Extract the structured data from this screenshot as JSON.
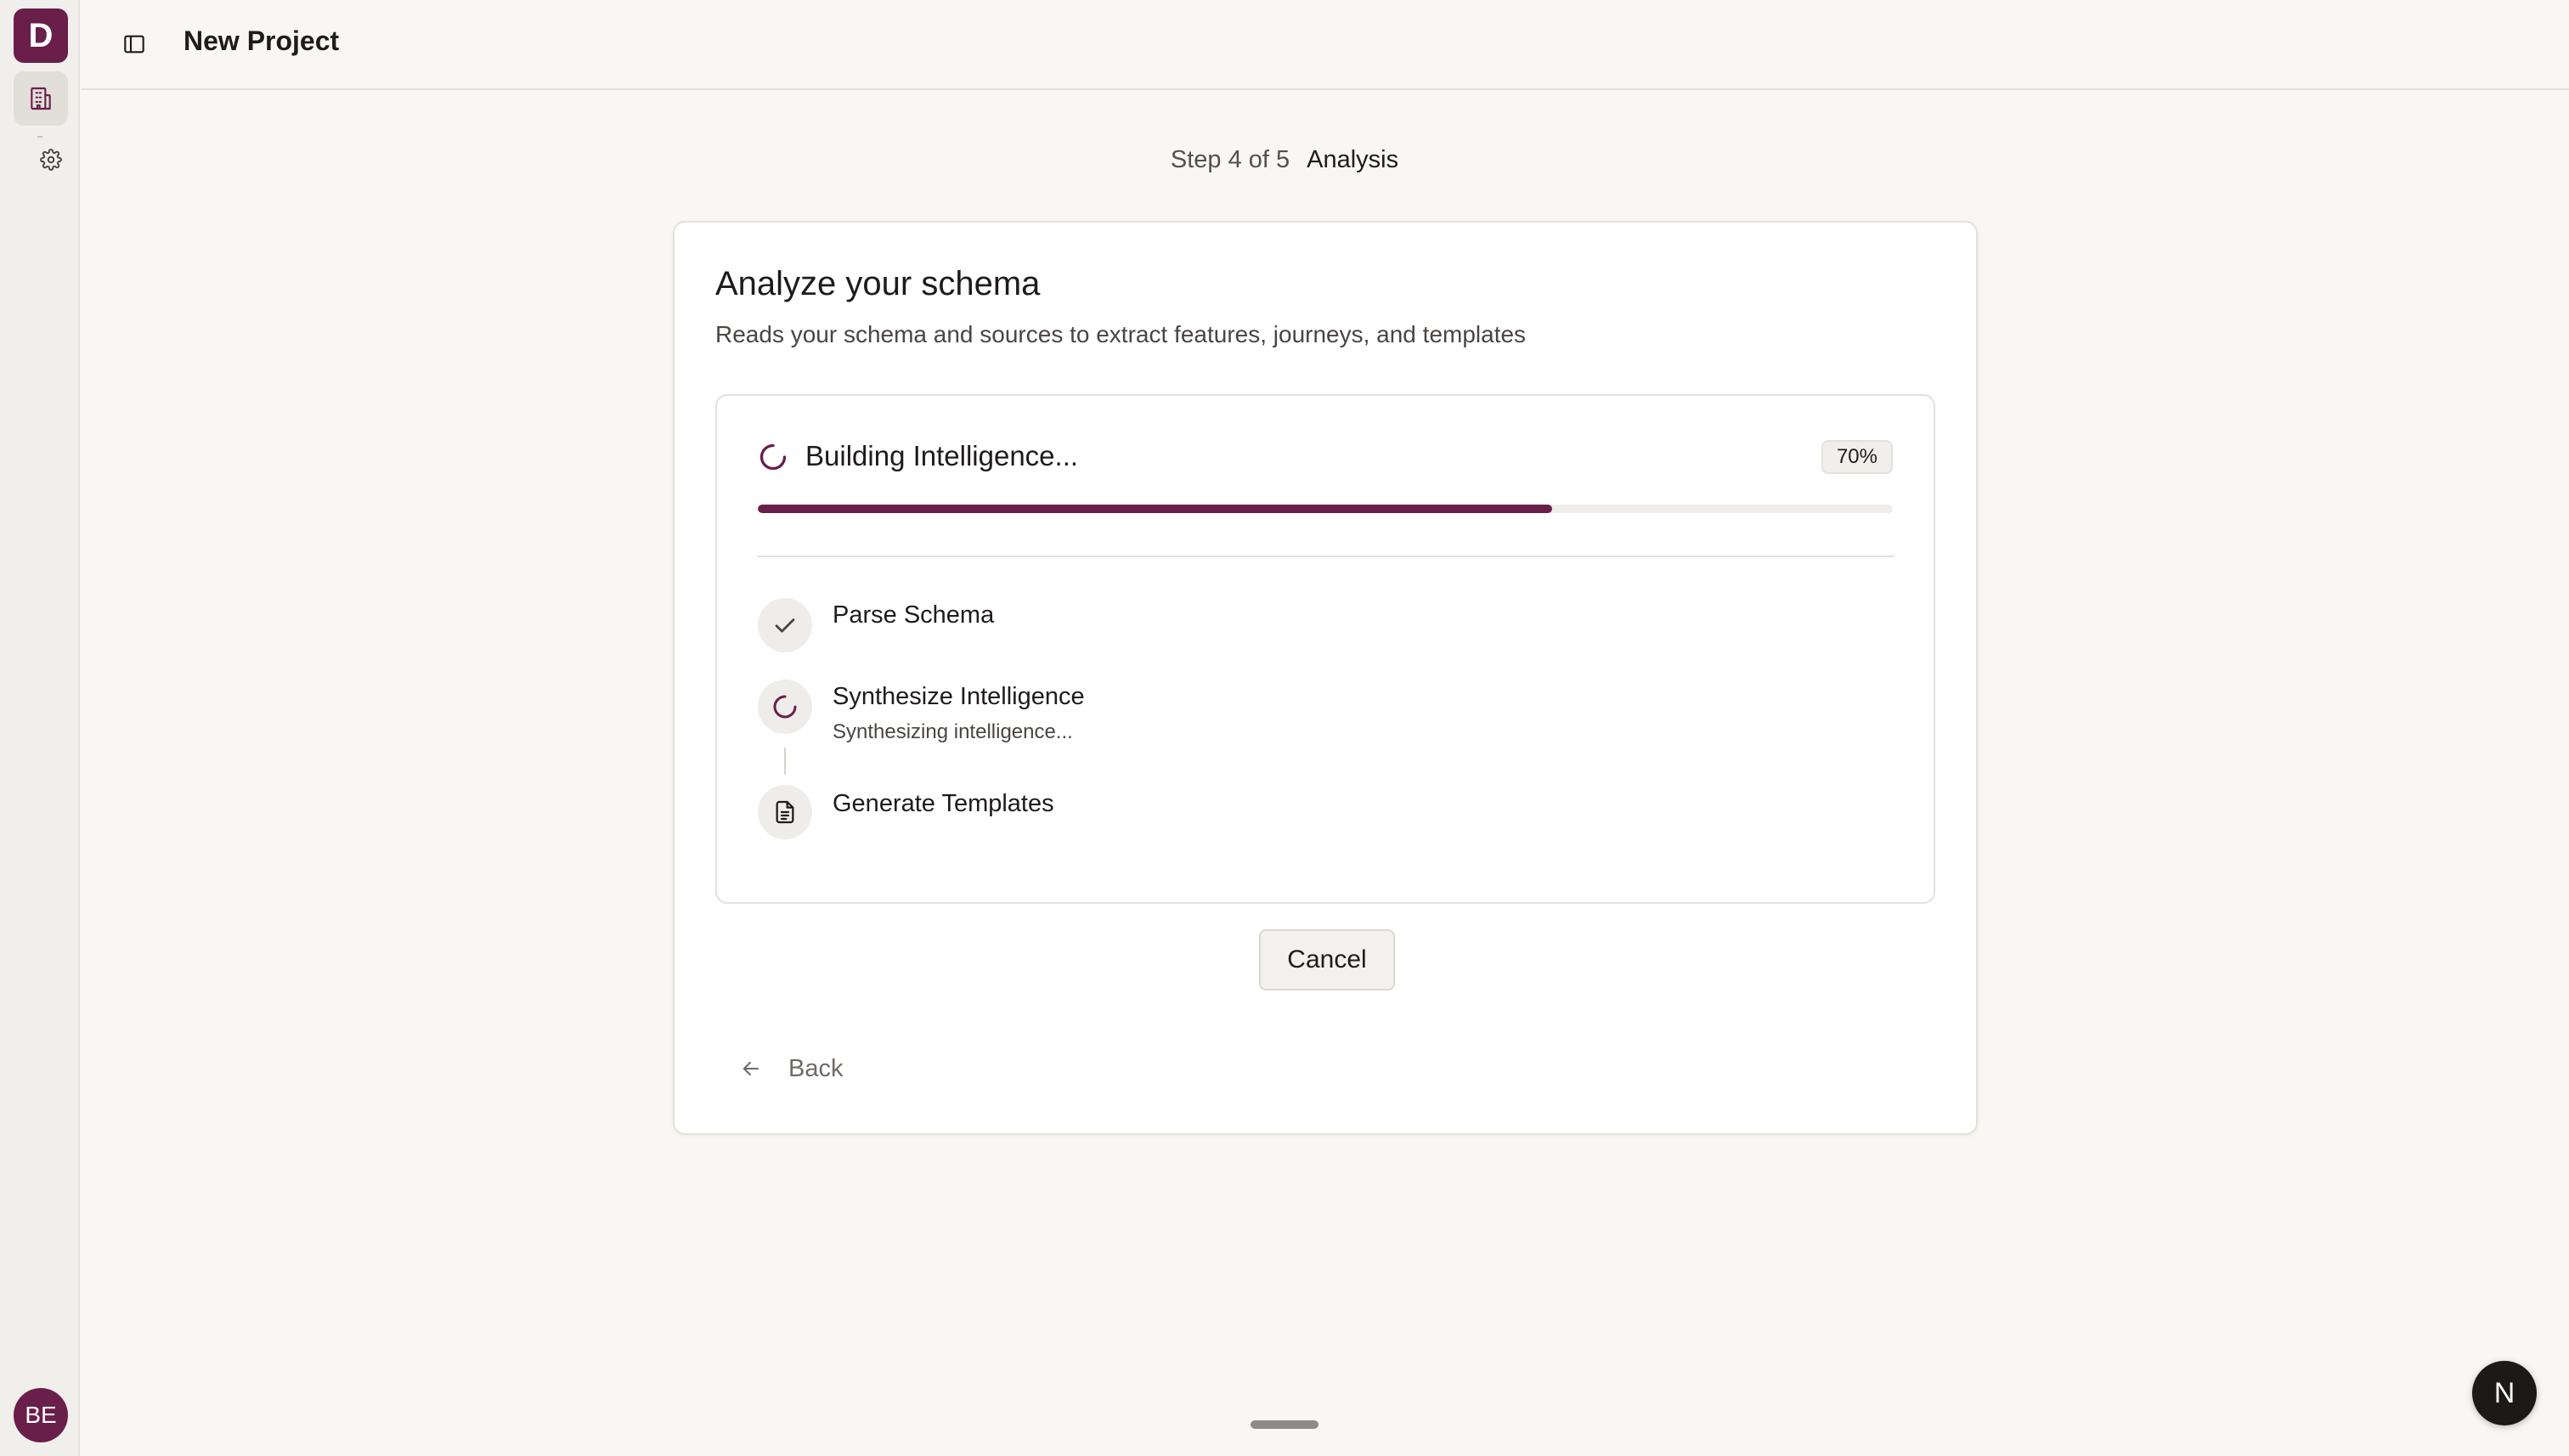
{
  "app": {
    "logo_letter": "D",
    "user_initials": "BE",
    "accent_color": "#6a1e4a",
    "fab_letter": "N"
  },
  "header": {
    "title": "New Project"
  },
  "stepper": {
    "step_text": "Step 4 of 5",
    "step_name": "Analysis"
  },
  "card": {
    "title": "Analyze your schema",
    "subtitle": "Reads your schema and sources to extract features, journeys, and templates"
  },
  "progress": {
    "status": "Building Intelligence...",
    "percent_label": "70%",
    "value": 0.7
  },
  "steps": [
    {
      "label": "Parse Schema",
      "description": "",
      "state": "done",
      "icon": "check-icon"
    },
    {
      "label": "Synthesize Intelligence",
      "description": "Synthesizing intelligence...",
      "state": "in-progress",
      "icon": "spinner-icon"
    },
    {
      "label": "Generate Templates",
      "description": "",
      "state": "pending",
      "icon": "document-icon"
    }
  ],
  "actions": {
    "cancel_label": "Cancel",
    "back_label": "Back"
  }
}
